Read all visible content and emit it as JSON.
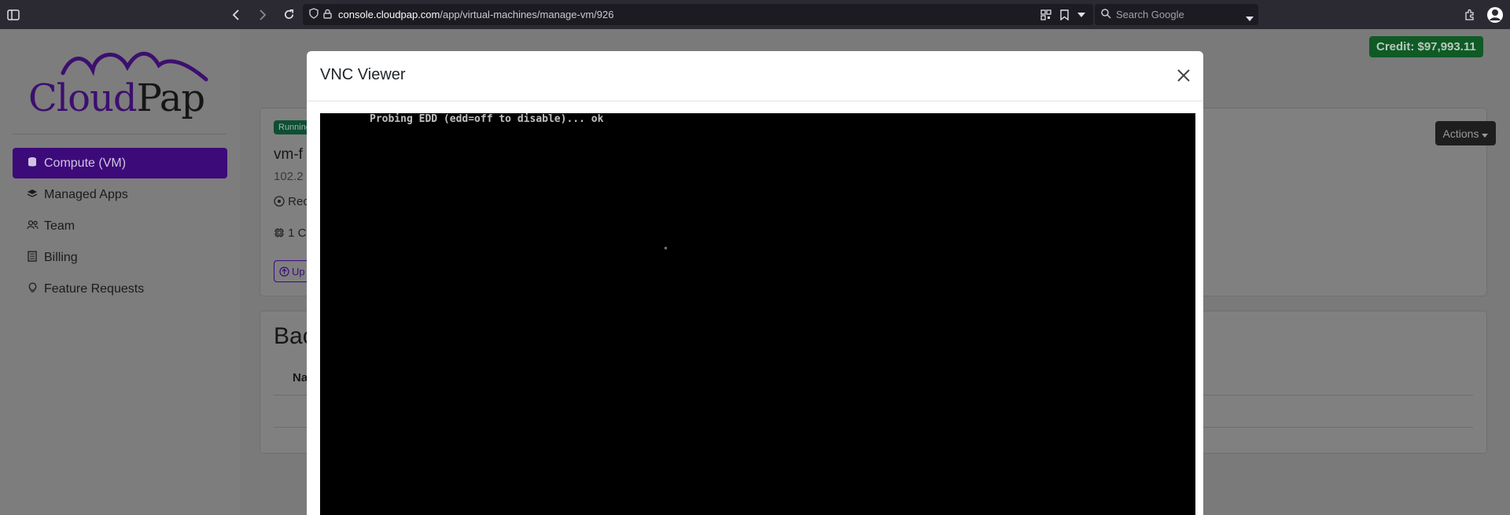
{
  "browser": {
    "url_domain": "console.cloudpap.com",
    "url_path": "/app/virtual-machines/manage-vm/926",
    "search_placeholder": "Search Google"
  },
  "sidebar": {
    "logo": {
      "part1": "Cloud",
      "part2": "Pap"
    },
    "items": [
      {
        "label": "Compute (VM)",
        "icon": "database-icon",
        "active": true
      },
      {
        "label": "Managed Apps",
        "icon": "layers-icon",
        "active": false
      },
      {
        "label": "Team",
        "icon": "people-icon",
        "active": false
      },
      {
        "label": "Billing",
        "icon": "receipt-icon",
        "active": false
      },
      {
        "label": "Feature Requests",
        "icon": "lightbulb-icon",
        "active": false
      }
    ]
  },
  "main": {
    "credit": "Credit: $97,993.11",
    "vm_card": {
      "status": "Running",
      "name": "vm-f",
      "ip": "102.2",
      "region": "Rec",
      "cpu": "1 C",
      "upgrade_label": "Up",
      "actions_label": "Actions"
    },
    "backups_card": {
      "title": "Bac",
      "column_name": "Na"
    }
  },
  "modal": {
    "title": "VNC Viewer",
    "console_line": "Probing EDD (edd=off to disable)... ok"
  },
  "colors": {
    "brand_purple": "#4a0f96",
    "credit_green": "#198754",
    "running_green": "#198754"
  }
}
